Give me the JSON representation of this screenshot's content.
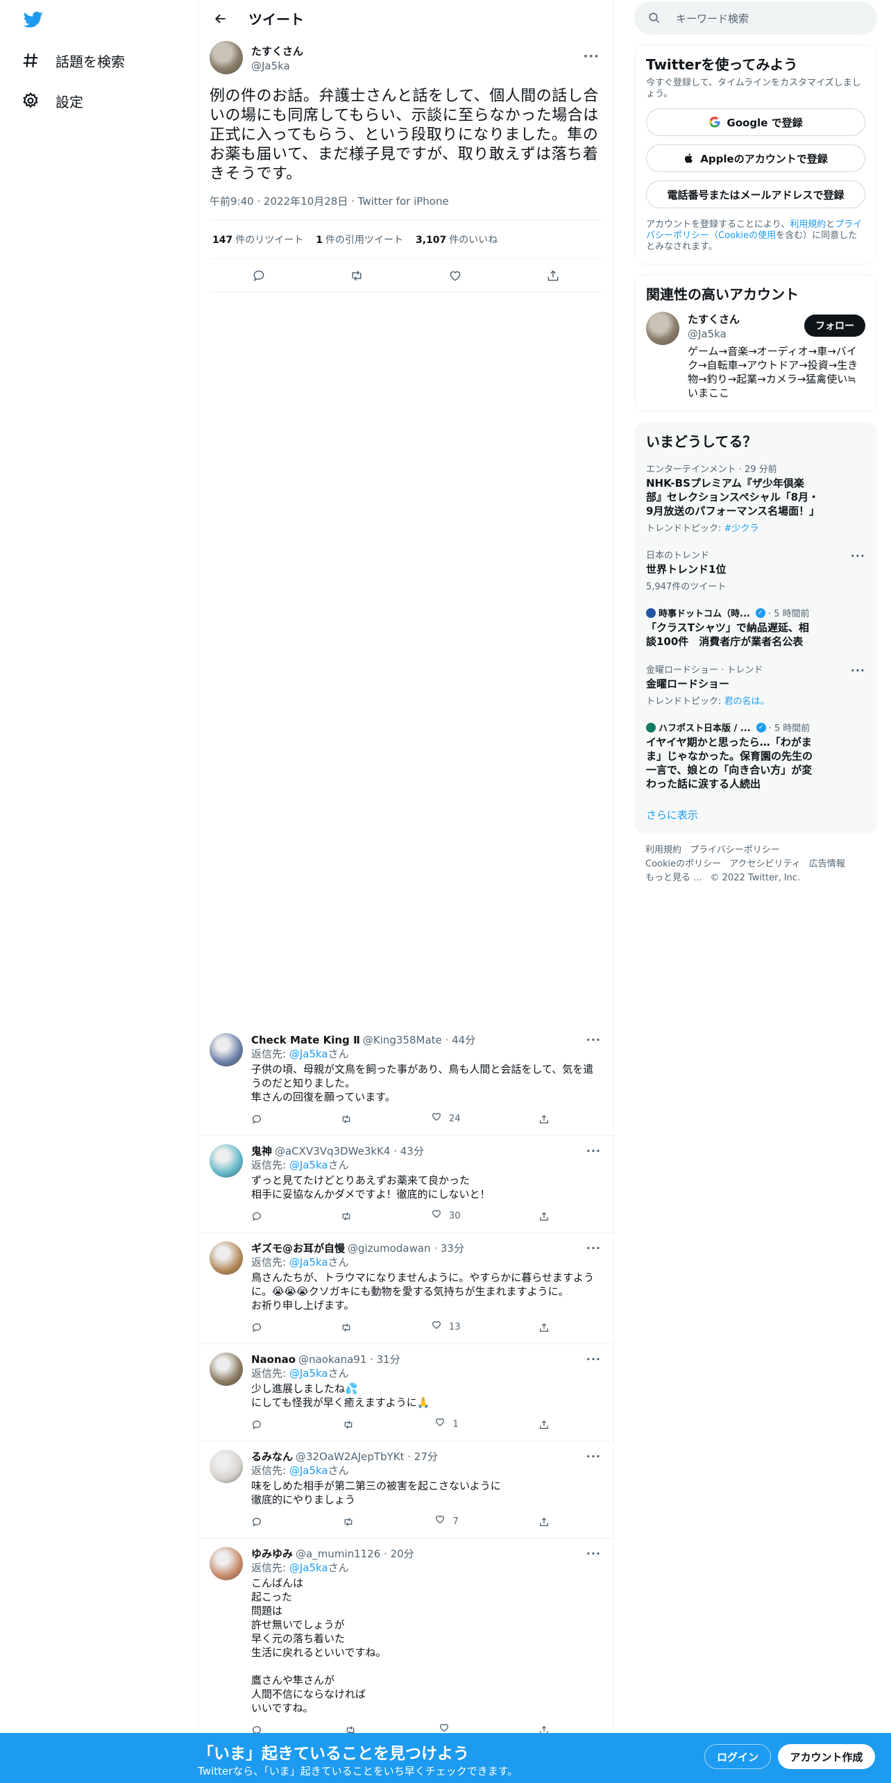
{
  "nav": {
    "explore_label": "話題を検索",
    "settings_label": "設定"
  },
  "header": {
    "title": "ツイート"
  },
  "tweet": {
    "name": "たすくさん",
    "handle": "@Ja5ka",
    "text": "例の件のお話。弁護士さんと話をして、個人間の話し合いの場にも同席してもらい、示談に至らなかった場合は正式に入ってもらう、という段取りになりました。隼のお薬も届いて、まだ様子見ですが、取り敢えずは落ち着きそうです。",
    "meta": "午前9:40 · 2022年10月28日 · Twitter for iPhone",
    "retweets_num": "147",
    "retweets_label": "件のリツイート",
    "quotes_num": "1",
    "quotes_label": "件の引用ツイート",
    "likes_num": "3,107",
    "likes_label": "件のいいね"
  },
  "replies": [
    {
      "name": "Check Mate King Ⅱ",
      "meta": "@King358Mate · 44分",
      "reply_to_prefix": "返信先: ",
      "reply_to_handle": "@Ja5ka",
      "reply_to_suffix": "さん",
      "text": "子供の頃、母親が文鳥を飼った事があり、鳥も人間と会話をして、気を遣うのだと知りました。\n隼さんの回復を願っています。",
      "likes": "24",
      "avatar_color": "#6b7fa8"
    },
    {
      "name": "鬼神",
      "meta": "@aCXV3Vq3DWe3kK4 · 43分",
      "reply_to_prefix": "返信先: ",
      "reply_to_handle": "@Ja5ka",
      "reply_to_suffix": "さん",
      "text": "ずっと見てたけどとりあえずお薬来て良かった\n相手に妥協なんかダメですよ！徹底的にしないと！",
      "likes": "30",
      "avatar_color": "#5fb8c9"
    },
    {
      "name": "ギズモ@お耳が自慢",
      "meta": "@gizumodawan · 33分",
      "reply_to_prefix": "返信先: ",
      "reply_to_handle": "@Ja5ka",
      "reply_to_suffix": "さん",
      "text": "鳥さんたちが、トラウマになりませんように。やすらかに暮らせますように。😭😭😭クソガキにも動物を愛する気持ちが生まれますように。\nお祈り申し上げます。",
      "likes": "13",
      "avatar_color": "#b58a5a"
    },
    {
      "name": "Naonao",
      "meta": "@naokana91 · 31分",
      "reply_to_prefix": "返信先: ",
      "reply_to_handle": "@Ja5ka",
      "reply_to_suffix": "さん",
      "text": "少し進展しましたね💦\nにしても怪我が早く癒えますように🙏",
      "likes": "1",
      "avatar_color": "#8a7a60"
    },
    {
      "name": "るみなん",
      "meta": "@32OaW2AJepTbYKt · 27分",
      "reply_to_prefix": "返信先: ",
      "reply_to_handle": "@Ja5ka",
      "reply_to_suffix": "さん",
      "text": "味をしめた相手が第二第三の被害を起こさないように\n徹底的にやりましょう",
      "likes": "7",
      "avatar_color": "#d8d2cc"
    },
    {
      "name": "ゆみゆみ",
      "meta": "@a_mumin1126 · 20分",
      "reply_to_prefix": "返信先: ",
      "reply_to_handle": "@Ja5ka",
      "reply_to_suffix": "さん",
      "text": "こんばんは\n起こった\n問題は\n許せ無いでしょうが\n早く元の落ち着いた\n生活に戻れるといいですね。\n\n鷹さんや隼さんが\n人間不信にならなければ\nいいですね。",
      "likes": "",
      "avatar_color": "#c98a6a"
    }
  ],
  "search": {
    "placeholder": "キーワード検索"
  },
  "signup_card": {
    "title": "Twitterを使ってみよう",
    "subtitle": "今すぐ登録して、タイムラインをカスタマイズしましょう。",
    "google_label": "Google で登録",
    "apple_label": "Appleのアカウントで登録",
    "phone_label": "電話番号またはメールアドレスで登録",
    "terms_prefix": "アカウントを登録することにより、",
    "terms_link1": "利用規約",
    "terms_and": "と",
    "terms_link2": "プライバシーポリシー（Cookieの使用",
    "terms_suffix": "を含む）に同意したとみなされます。"
  },
  "related": {
    "title": "関連性の高いアカウント",
    "name": "たすくさん",
    "handle": "@Ja5ka",
    "follow_label": "フォロー",
    "bio": "ゲーム→音楽→オーディオ→車→バイク→自転車→アウトドア→投資→生き物→釣り→起業→カメラ→猛禽使い≒いまここ"
  },
  "trends": {
    "title": "いまどうしてる？",
    "items": [
      {
        "cat": "エンターテインメント · 29 分前",
        "title": "NHK-BSプレミアム『ザ少年倶楽部』セレクションスペシャル「8月・9月放送のパフォーマンス名場面！」",
        "extra_prefix": "トレンドトピック: ",
        "extra_link": "#少クラ"
      },
      {
        "cat": "日本のトレンド",
        "title": "世界トレンド1位",
        "count": "5,947件のツイート"
      },
      {
        "source": "時事ドットコム（時...",
        "source_time": "· 5 時間前",
        "title": "「クラスTシャツ」で納品遅延、相談100件　消費者庁が業者名公表"
      },
      {
        "cat": "金曜ロードショー · トレンド",
        "title": "金曜ロードショー",
        "extra_prefix": "トレンドトピック: ",
        "extra_link": "君の名は。"
      },
      {
        "source": "ハフポスト日本版 / ...",
        "source_time": "· 5 時間前",
        "title": "イヤイヤ期かと思ったら…「わがまま」じゃなかった。保育園の先生の一言で、娘との「向き合い方」が変わった話に涙する人続出"
      }
    ],
    "show_more": "さらに表示"
  },
  "footer": {
    "l1": "利用規約",
    "l2": "プライバシーポリシー",
    "l3": "Cookieのポリシー",
    "l4": "アクセシビリティ",
    "l5": "広告情報",
    "l6": "もっと見る ...",
    "copyright": "© 2022 Twitter, Inc."
  },
  "banner": {
    "title": "「いま」起きていることを見つけよう",
    "subtitle": "Twitterなら、「いま」起きていることをいち早くチェックできます。",
    "login": "ログイン",
    "signup": "アカウント作成"
  },
  "colors": {
    "accent": "#1d9bf0",
    "text": "#0f1419",
    "muted": "#536471"
  }
}
